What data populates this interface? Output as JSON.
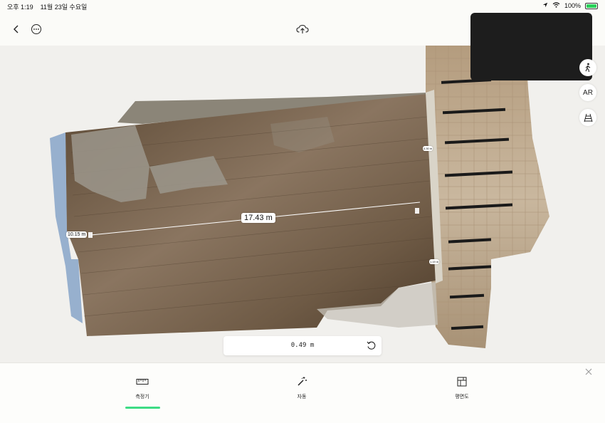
{
  "status_bar": {
    "time": "오후 1:19",
    "date": "11월 23일 수요일",
    "battery": "100%",
    "battery_level": 1.0,
    "icons": [
      "location-arrow-icon",
      "wifi-icon",
      "battery-charging-icon"
    ]
  },
  "nav": {
    "icons": [
      "back-chevron-icon",
      "more-ellipsis-icon",
      "cloud-upload-icon"
    ]
  },
  "measurements": {
    "main_length": "17.43 m",
    "left_width": "10.15 m",
    "wall_label_a": "4.30 m",
    "wall_label_b": "1.19 m"
  },
  "side_tools": [
    {
      "name": "walk-icon",
      "label": ""
    },
    {
      "name": "ar",
      "label": "AR"
    },
    {
      "name": "perspective-icon",
      "label": ""
    }
  ],
  "dimension_panel": {
    "value": "0.49 m",
    "icon": "reset-rotate-icon"
  },
  "tabs": [
    {
      "label": "측정기",
      "icon": "ruler-icon",
      "selected": true
    },
    {
      "label": "자동",
      "icon": "magic-wand-icon",
      "selected": false
    },
    {
      "label": "평면도",
      "icon": "floorplan-icon",
      "selected": false
    }
  ],
  "colors": {
    "accent": "#3ddc84",
    "background": "#f3f2ef",
    "pip": "#1d1d1d"
  }
}
